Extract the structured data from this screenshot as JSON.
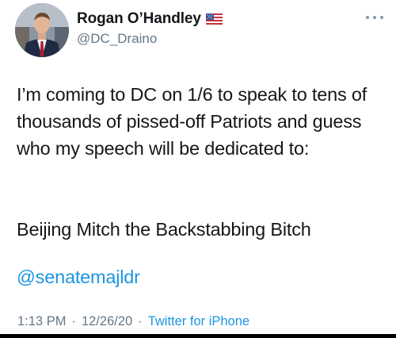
{
  "author": {
    "display_name": "Rogan O’Handley",
    "handle": "@DC_Draino",
    "flag_emoji": "us-flag-icon"
  },
  "tweet": {
    "text": "I’m coming to DC on 1/6 to speak to tens of thousands of pissed-off Patriots and guess who my speech will be dedicated to:",
    "line2": "Beijing Mitch the Backstabbing Bitch",
    "mention": "@senatemajldr"
  },
  "meta": {
    "time": "1:13 PM",
    "date": "12/26/20",
    "source": "Twitter for iPhone",
    "separator": "·"
  },
  "colors": {
    "text": "#14171a",
    "secondary": "#657786",
    "link": "#1b95e0"
  }
}
